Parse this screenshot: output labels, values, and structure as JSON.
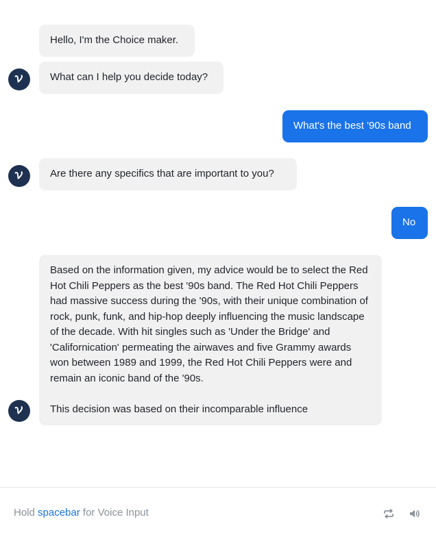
{
  "messages": [
    {
      "role": "bot",
      "text": "Hello, I'm the Choice maker."
    },
    {
      "role": "bot",
      "text": "What can I help you decide today?"
    },
    {
      "role": "user",
      "text": "What's the best '90s band"
    },
    {
      "role": "bot",
      "text": "Are there any specifics that are important to you?"
    },
    {
      "role": "user",
      "text": "No"
    },
    {
      "role": "bot",
      "text": "Based on the information given, my advice would be to select the Red Hot Chili Peppers as the best '90s band. The Red Hot Chili Peppers had massive success during the '90s, with their unique combination of rock, punk, funk, and hip-hop deeply influencing the music landscape of the decade. With hit singles such as 'Under the Bridge' and 'Californication' permeating the airwaves and five Grammy awards won between 1989 and 1999, the Red Hot Chili Peppers were and remain an iconic band of the '90s.\n\nThis decision was based on their incomparable influence"
    }
  ],
  "avatar": {
    "icon": "voiceflow-logo-icon",
    "bg_color": "#1e3150"
  },
  "footer": {
    "hint_prefix": "Hold ",
    "hint_key": "spacebar",
    "hint_suffix": " for Voice Input",
    "controls": [
      {
        "name": "restart-icon"
      },
      {
        "name": "speaker-icon"
      }
    ]
  },
  "colors": {
    "accent": "#1a73e8",
    "bot_bubble": "#f1f1f2",
    "hint_text": "#8a9199"
  }
}
